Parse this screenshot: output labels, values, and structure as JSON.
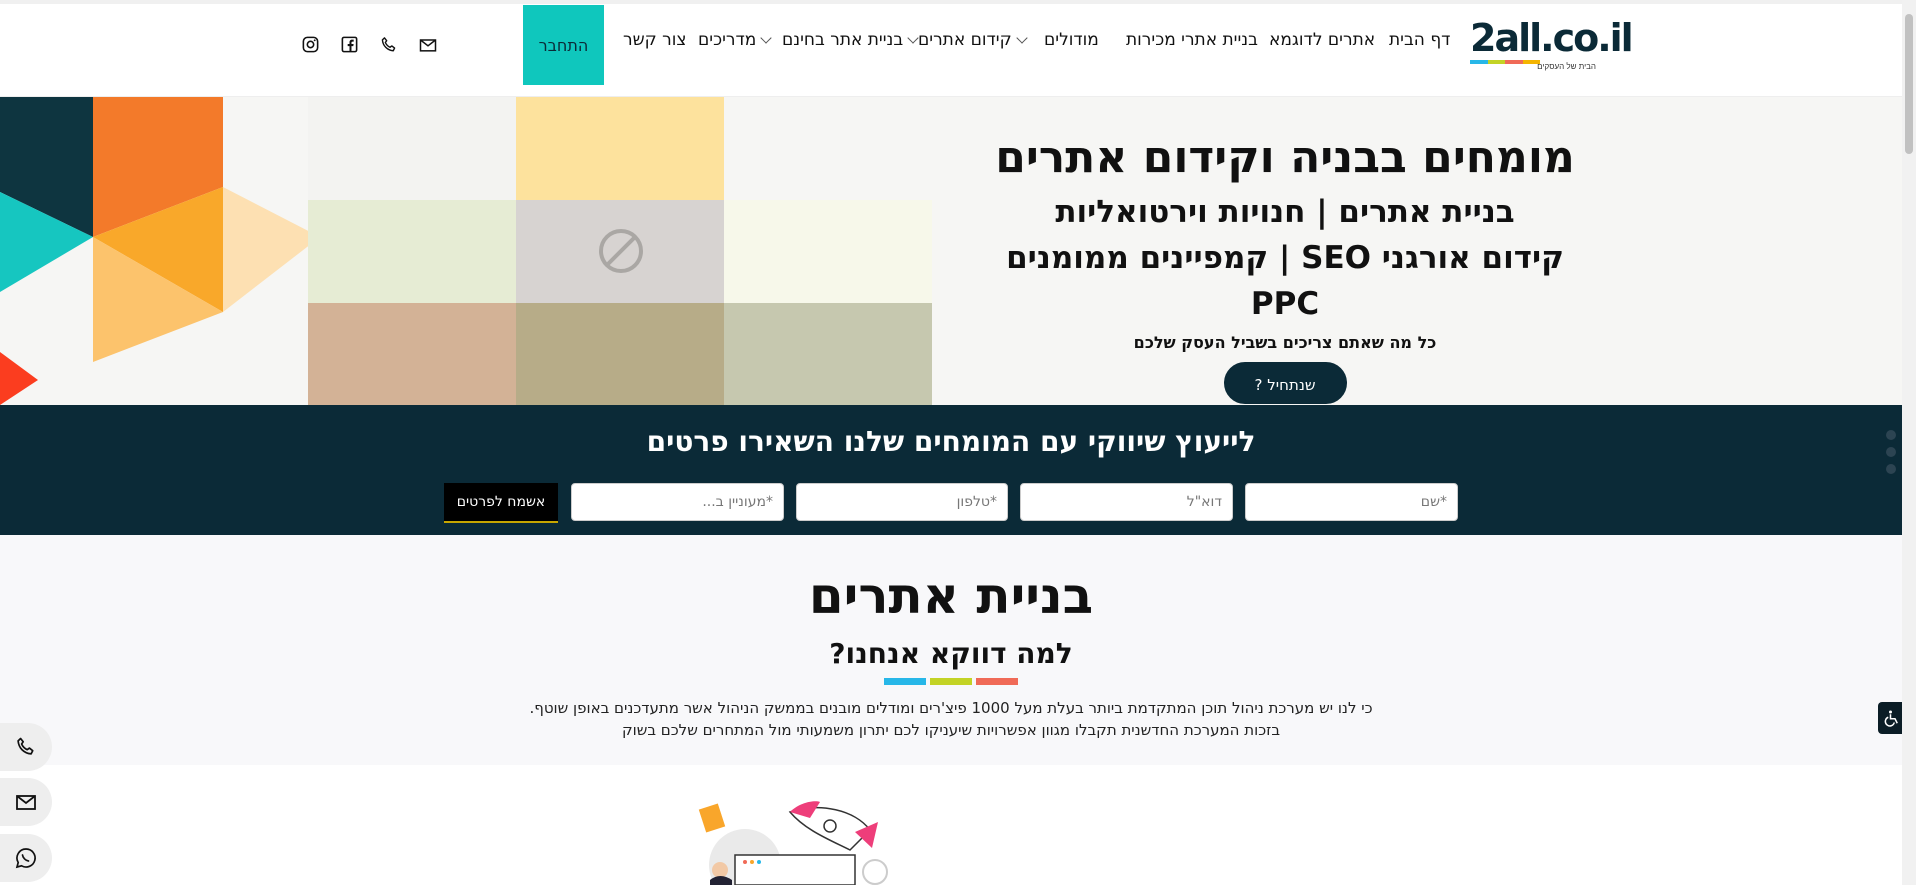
{
  "brand": {
    "logo_text": "2all.co.il",
    "tagline": "הבית של העסקים",
    "bar_colors": [
      "#27b7e8",
      "#c3d325",
      "#f06a57",
      "#f4b400"
    ]
  },
  "nav": {
    "items": [
      {
        "label": "דף הבית"
      },
      {
        "label": "אתרים לדוגמא"
      },
      {
        "label": "בניית אתרי מכירות"
      },
      {
        "label": "מודולים"
      },
      {
        "label": "קידום אתרים"
      },
      {
        "label": "בניית אתר בחינם"
      },
      {
        "label": "מדריכים"
      },
      {
        "label": "צור קשר"
      }
    ],
    "login_label": "התחבר",
    "accent": "#0fc7bd"
  },
  "hero": {
    "title": "מומחים בבניה וקידום אתרים",
    "line1": "בניית אתרים | חנויות וירטואליות",
    "line2": "קידום אורגני SEO | קמפיינים ממומנים PPC",
    "subtitle": "כל מה שאתם צריכים בשביל העסק שלכם",
    "cta_label": "שנתחיל ?"
  },
  "consult": {
    "title": "לייעוץ שיווקי עם המומחים שלנו השאירו פרטים",
    "name_placeholder": "*שם",
    "email_placeholder": "דוא\"ל",
    "phone_placeholder": "*טלפון",
    "interest_placeholder": "*מעוניין ב...",
    "submit_label": "אשמח לפרטים",
    "bg": "#0b2a37"
  },
  "section": {
    "title": "בניית אתרים",
    "subtitle": "למה דווקא אנחנו?",
    "body_line1": "כי לנו יש מערכת ניהול תוכן המתקדמת ביותר בעלת מעל 1000 פיצ'רים ומודלים מובנים בממשק הניהול אשר מתעדכנים באופן שוטף.",
    "body_line2": "בזכות המערכת החדשנית תקבלו מגוון אפשרויות שיעניקו לכם יתרון משמעותי מול המתחרים שלכם בשוק"
  }
}
